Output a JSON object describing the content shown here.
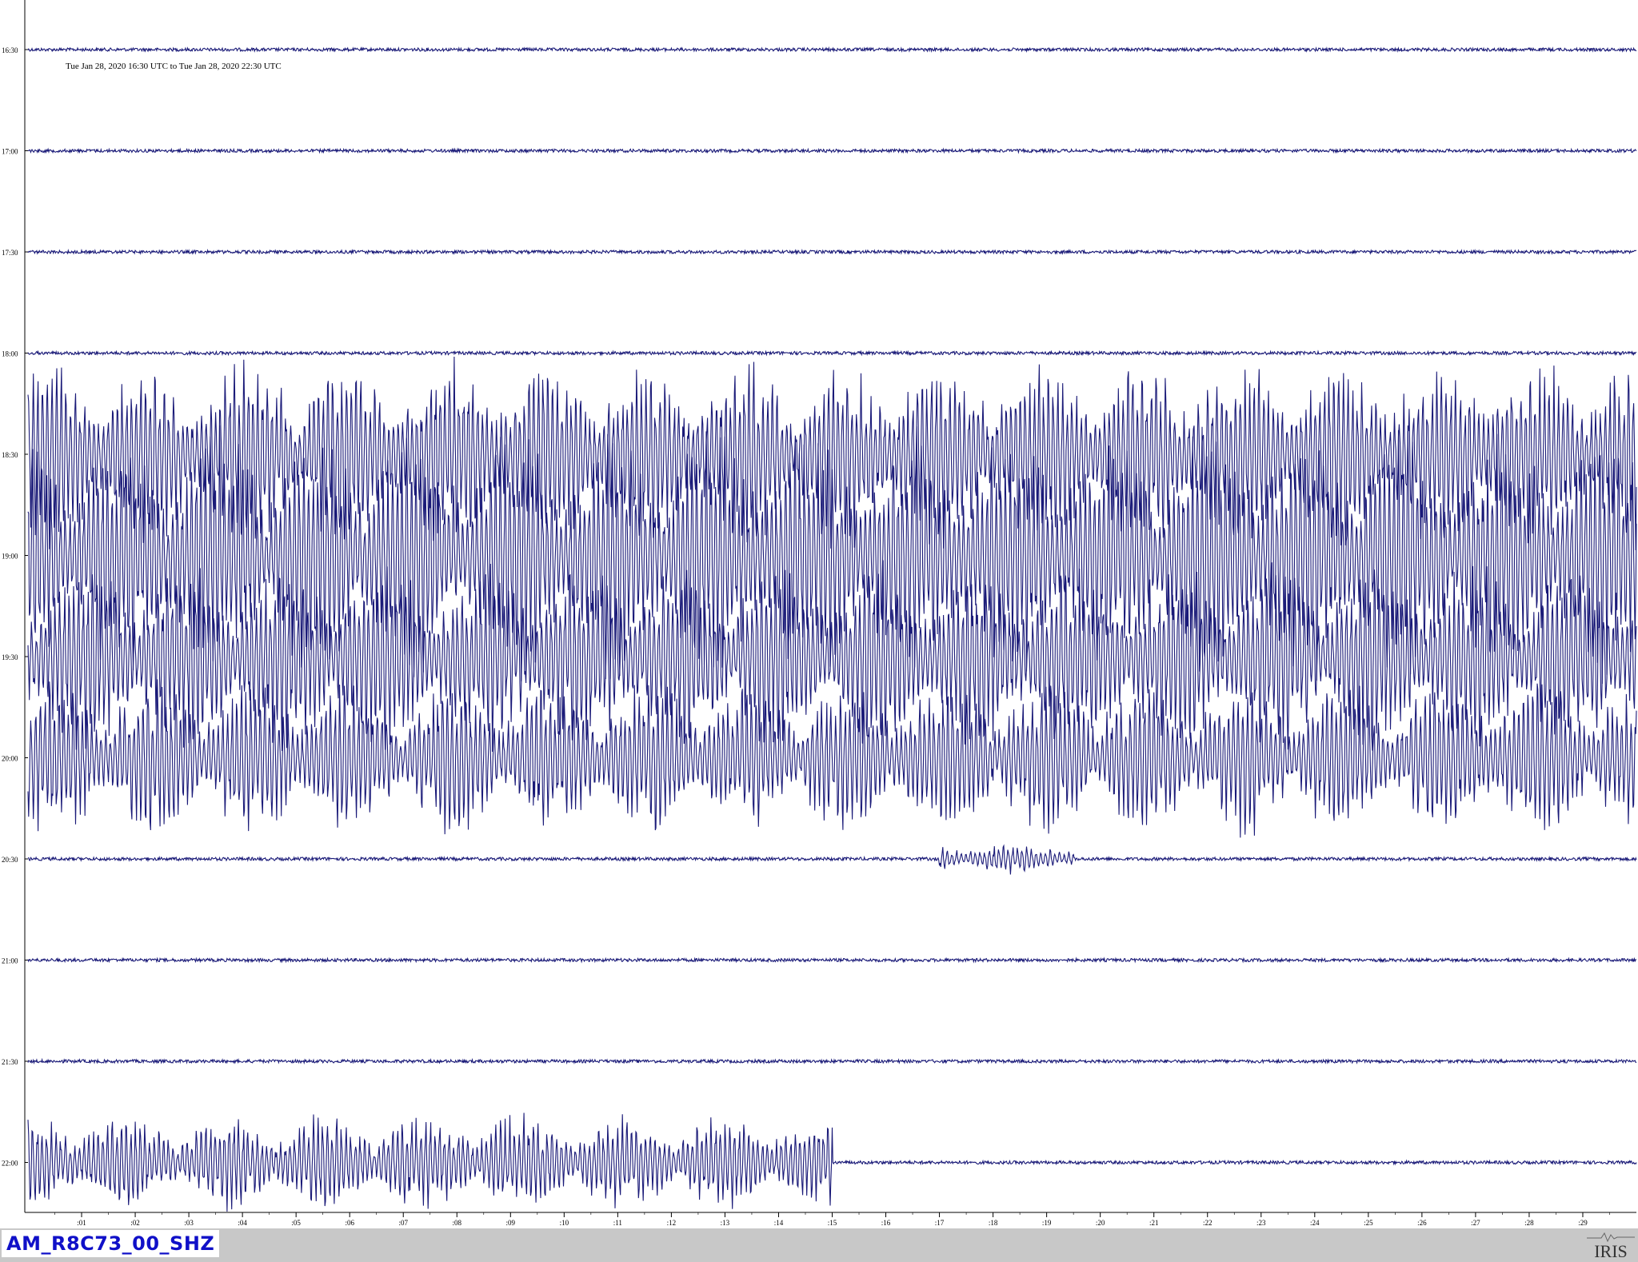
{
  "chart_data": {
    "type": "line",
    "title": "Tue Jan 28, 2020 16:30 UTC to Tue Jan 28, 2020 22:30 UTC",
    "row_labels": [
      "16:30",
      "17:00",
      "17:30",
      "18:00",
      "18:30",
      "19:00",
      "19:30",
      "20:00",
      "20:30",
      "21:00",
      "21:30",
      "22:00"
    ],
    "x_ticks": [
      ":01",
      ":02",
      ":03",
      ":04",
      ":05",
      ":06",
      ":07",
      ":08",
      ":09",
      ":10",
      ":11",
      ":12",
      ":13",
      ":14",
      ":15",
      ":16",
      ":17",
      ":18",
      ":19",
      ":20",
      ":21",
      ":22",
      ":23",
      ":24",
      ":25",
      ":26",
      ":27",
      ":28",
      ":29"
    ],
    "x_unit": "minutes within 30-minute row",
    "x_range": [
      0,
      30
    ],
    "grid": true,
    "trace_color": "#1a1a78",
    "events": [
      {
        "row": "18:30",
        "start_min": 0,
        "end_min": 30,
        "amplitude": 1.0
      },
      {
        "row": "19:00",
        "start_min": 0,
        "end_min": 30,
        "amplitude": 1.3
      },
      {
        "row": "19:30",
        "start_min": 0,
        "end_min": 30,
        "amplitude": 1.0
      },
      {
        "row": "20:00",
        "start_min": 0,
        "end_min": 30,
        "amplitude": 0.8
      },
      {
        "row": "20:30",
        "start_min": 17,
        "end_min": 19.5,
        "amplitude": 0.15
      },
      {
        "row": "22:00",
        "start_min": 0,
        "end_min": 15,
        "amplitude": 0.5
      }
    ]
  },
  "station": "AM_R8C73_00_SHZ",
  "logo": "IRIS"
}
